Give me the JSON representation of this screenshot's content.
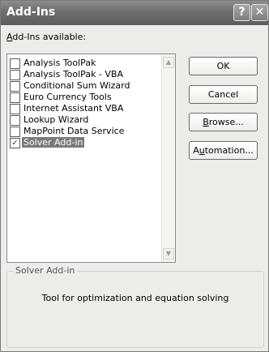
{
  "window": {
    "title": "Add-Ins",
    "help_glyph": "?",
    "close_glyph": "✕"
  },
  "addins_label_prefix": "A",
  "addins_label_rest": "dd-Ins available:",
  "addins": [
    {
      "label": "Analysis ToolPak",
      "checked": false,
      "selected": false
    },
    {
      "label": "Analysis ToolPak - VBA",
      "checked": false,
      "selected": false
    },
    {
      "label": "Conditional Sum Wizard",
      "checked": false,
      "selected": false
    },
    {
      "label": "Euro Currency Tools",
      "checked": false,
      "selected": false
    },
    {
      "label": "Internet Assistant VBA",
      "checked": false,
      "selected": false
    },
    {
      "label": "Lookup Wizard",
      "checked": false,
      "selected": false
    },
    {
      "label": "MapPoint Data Service",
      "checked": false,
      "selected": false
    },
    {
      "label": "Solver Add-in",
      "checked": true,
      "selected": true
    }
  ],
  "check_glyph": "✓",
  "scroll_up_glyph": "▲",
  "scroll_down_glyph": "▼",
  "buttons": {
    "ok": "OK",
    "cancel": "Cancel",
    "browse_prefix": "B",
    "browse_rest": "rowse...",
    "automation_prefix": "A",
    "automation_mnemonic": "u",
    "automation_rest": "tomation..."
  },
  "details": {
    "title": "Solver Add-in",
    "description": "Tool for optimization and equation solving"
  }
}
